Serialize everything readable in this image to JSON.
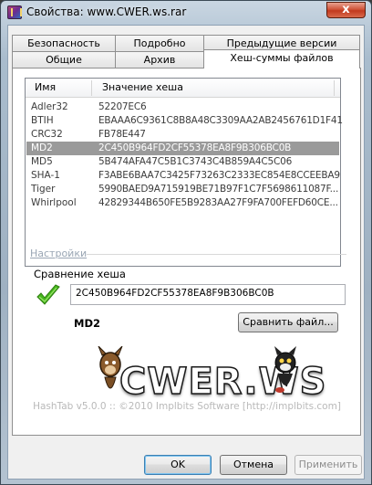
{
  "window": {
    "title": "Свойства: www.CWER.ws.rar",
    "close_glyph": "x"
  },
  "tabs": {
    "row1": [
      "Безопасность",
      "Подробно",
      "Предыдущие версии"
    ],
    "row2": [
      "Общие",
      "Архив",
      "Хеш-суммы файлов"
    ],
    "active": "Хеш-суммы файлов"
  },
  "hash_list": {
    "columns": [
      "Имя",
      "Значение хеша"
    ],
    "rows": [
      {
        "name": "Adler32",
        "value": "52207EC6"
      },
      {
        "name": "BTIH",
        "value": "EBAAA6C9361C8B8A48C3309AA2AB2456761D1F41"
      },
      {
        "name": "CRC32",
        "value": "FB78E447"
      },
      {
        "name": "MD2",
        "value": "2C450B964FD2CF55378EA8F9B306BC0B",
        "selected": true
      },
      {
        "name": "MD5",
        "value": "5B474AFA47C5B1C3743C4B859A4C5C06"
      },
      {
        "name": "SHA-1",
        "value": "F3ABE6BAA7C3425F73263C2333EC854E8CCEEBA9"
      },
      {
        "name": "Tiger",
        "value": "5990BAED9A715919BE71B97F1C7F5698611087F..."
      },
      {
        "name": "Whirlpool",
        "value": "42829344B650FE5B9283AA27F9FA700FEFD60CE..."
      }
    ]
  },
  "settings_link": "Настройки",
  "compare": {
    "label": "Сравнение хеша",
    "value": "2C450B964FD2CF55378EA8F9B306BC0B",
    "algorithm": "MD2",
    "button": "Сравнить файл...",
    "check_icon": "green-checkmark-icon",
    "check_color": "#46b81c"
  },
  "logo_text": "CWER.WS",
  "copyright": "HashTab v5.0.0 :: ©2010 Implbits Software [http://implbits.com]",
  "buttons": {
    "ok": "OK",
    "cancel": "Отмена",
    "apply": "Применить"
  },
  "colors": {
    "selection": "#9a9a9a",
    "close": "#c23a1e"
  }
}
